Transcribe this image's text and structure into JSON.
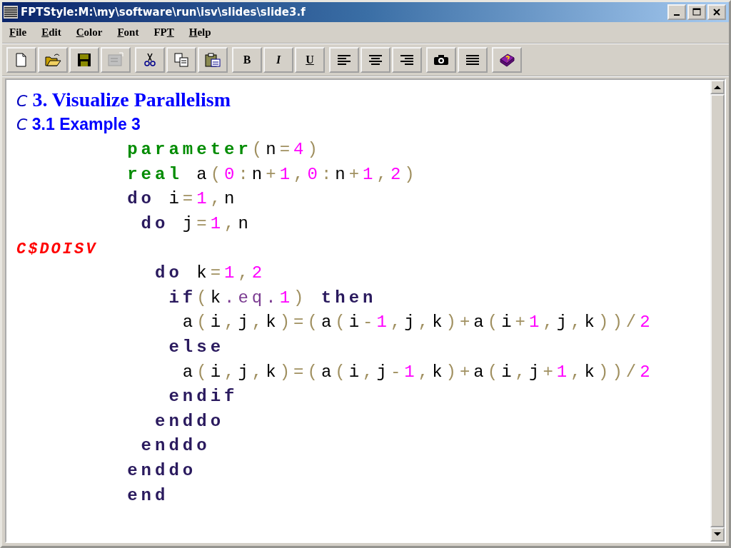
{
  "window": {
    "title": "FPTStyle:M:\\my\\software\\run\\isv\\slides\\slide3.f"
  },
  "menu": [
    {
      "accelerator": "F",
      "after": "ile"
    },
    {
      "accelerator": "E",
      "after": "dit"
    },
    {
      "accelerator": "C",
      "after": "olor"
    },
    {
      "accelerator": "F",
      "after": "ont"
    },
    {
      "before": "FP",
      "accelerator": "T"
    },
    {
      "accelerator": "H",
      "after": "elp"
    }
  ],
  "toolbar": [
    [
      {
        "kind": "icon",
        "disabled": false
      },
      {
        "kind": "icon",
        "disabled": false
      },
      {
        "kind": "icon",
        "disabled": false
      },
      {
        "kind": "icon",
        "disabled": true
      }
    ],
    [
      {
        "kind": "icon",
        "disabled": false
      },
      {
        "kind": "icon",
        "disabled": false
      },
      {
        "kind": "icon",
        "disabled": false
      }
    ],
    [
      {
        "kind": "text",
        "label": "B",
        "disabled": false
      },
      {
        "kind": "text",
        "label": "I",
        "disabled": false
      },
      {
        "kind": "text",
        "label": "U",
        "disabled": false
      }
    ],
    [
      {
        "kind": "icon",
        "disabled": false
      },
      {
        "kind": "icon",
        "disabled": false
      },
      {
        "kind": "icon",
        "disabled": false
      }
    ],
    [
      {
        "kind": "icon",
        "disabled": false
      },
      {
        "kind": "icon",
        "disabled": false
      }
    ],
    [
      {
        "kind": "icon",
        "disabled": false
      }
    ]
  ],
  "editor": {
    "lines": [
      [
        {
          "kind": "comment-mark",
          "text": "C"
        },
        {
          "kind": "heading",
          "text": " 3. Visualize Parallelism"
        }
      ],
      [
        {
          "kind": "comment-mark",
          "text": "C"
        },
        {
          "kind": "subheading",
          "text": " 3.1 Example 3"
        }
      ],
      [
        {
          "kind": "decl",
          "text": "        parameter"
        },
        {
          "kind": "op",
          "text": "("
        },
        {
          "kind": "ident",
          "text": "n"
        },
        {
          "kind": "op",
          "text": "="
        },
        {
          "kind": "number",
          "text": "4"
        },
        {
          "kind": "op",
          "text": ")"
        }
      ],
      [
        {
          "kind": "decl",
          "text": "        real"
        },
        {
          "kind": "ident",
          "text": " a"
        },
        {
          "kind": "op",
          "text": "("
        },
        {
          "kind": "number",
          "text": "0"
        },
        {
          "kind": "op",
          "text": ":"
        },
        {
          "kind": "ident",
          "text": "n"
        },
        {
          "kind": "op",
          "text": "+"
        },
        {
          "kind": "number",
          "text": "1"
        },
        {
          "kind": "op",
          "text": ","
        },
        {
          "kind": "number",
          "text": "0"
        },
        {
          "kind": "op",
          "text": ":"
        },
        {
          "kind": "ident",
          "text": "n"
        },
        {
          "kind": "op",
          "text": "+"
        },
        {
          "kind": "number",
          "text": "1"
        },
        {
          "kind": "op",
          "text": ","
        },
        {
          "kind": "number",
          "text": "2"
        },
        {
          "kind": "op",
          "text": ")"
        }
      ],
      [
        {
          "kind": "keyword",
          "text": "        do"
        },
        {
          "kind": "ident",
          "text": " i"
        },
        {
          "kind": "op",
          "text": "="
        },
        {
          "kind": "number",
          "text": "1"
        },
        {
          "kind": "op",
          "text": ","
        },
        {
          "kind": "ident",
          "text": "n"
        }
      ],
      [
        {
          "kind": "keyword",
          "text": "         do"
        },
        {
          "kind": "ident",
          "text": " j"
        },
        {
          "kind": "op",
          "text": "="
        },
        {
          "kind": "number",
          "text": "1"
        },
        {
          "kind": "op",
          "text": ","
        },
        {
          "kind": "ident",
          "text": "n"
        }
      ],
      [
        {
          "kind": "directive",
          "text": "C$DOISV"
        }
      ],
      [
        {
          "kind": "keyword",
          "text": "          do"
        },
        {
          "kind": "ident",
          "text": " k"
        },
        {
          "kind": "op",
          "text": "="
        },
        {
          "kind": "number",
          "text": "1"
        },
        {
          "kind": "op",
          "text": ","
        },
        {
          "kind": "number",
          "text": "2"
        }
      ],
      [
        {
          "kind": "keyword",
          "text": "           if"
        },
        {
          "kind": "op",
          "text": "("
        },
        {
          "kind": "ident",
          "text": "k"
        },
        {
          "kind": "relop",
          "text": ".eq."
        },
        {
          "kind": "number",
          "text": "1"
        },
        {
          "kind": "op",
          "text": ")"
        },
        {
          "kind": "keyword",
          "text": " then"
        }
      ],
      [
        {
          "kind": "ident",
          "text": "            a"
        },
        {
          "kind": "op",
          "text": "("
        },
        {
          "kind": "ident",
          "text": "i"
        },
        {
          "kind": "op",
          "text": ","
        },
        {
          "kind": "ident",
          "text": "j"
        },
        {
          "kind": "op",
          "text": ","
        },
        {
          "kind": "ident",
          "text": "k"
        },
        {
          "kind": "op",
          "text": ")=("
        },
        {
          "kind": "ident",
          "text": "a"
        },
        {
          "kind": "op",
          "text": "("
        },
        {
          "kind": "ident",
          "text": "i"
        },
        {
          "kind": "op",
          "text": "-"
        },
        {
          "kind": "number",
          "text": "1"
        },
        {
          "kind": "op",
          "text": ","
        },
        {
          "kind": "ident",
          "text": "j"
        },
        {
          "kind": "op",
          "text": ","
        },
        {
          "kind": "ident",
          "text": "k"
        },
        {
          "kind": "op",
          "text": ")+"
        },
        {
          "kind": "ident",
          "text": "a"
        },
        {
          "kind": "op",
          "text": "("
        },
        {
          "kind": "ident",
          "text": "i"
        },
        {
          "kind": "op",
          "text": "+"
        },
        {
          "kind": "number",
          "text": "1"
        },
        {
          "kind": "op",
          "text": ","
        },
        {
          "kind": "ident",
          "text": "j"
        },
        {
          "kind": "op",
          "text": ","
        },
        {
          "kind": "ident",
          "text": "k"
        },
        {
          "kind": "op",
          "text": "))/"
        },
        {
          "kind": "number",
          "text": "2"
        }
      ],
      [
        {
          "kind": "keyword",
          "text": "           else"
        }
      ],
      [
        {
          "kind": "ident",
          "text": "            a"
        },
        {
          "kind": "op",
          "text": "("
        },
        {
          "kind": "ident",
          "text": "i"
        },
        {
          "kind": "op",
          "text": ","
        },
        {
          "kind": "ident",
          "text": "j"
        },
        {
          "kind": "op",
          "text": ","
        },
        {
          "kind": "ident",
          "text": "k"
        },
        {
          "kind": "op",
          "text": ")=("
        },
        {
          "kind": "ident",
          "text": "a"
        },
        {
          "kind": "op",
          "text": "("
        },
        {
          "kind": "ident",
          "text": "i"
        },
        {
          "kind": "op",
          "text": ","
        },
        {
          "kind": "ident",
          "text": "j"
        },
        {
          "kind": "op",
          "text": "-"
        },
        {
          "kind": "number",
          "text": "1"
        },
        {
          "kind": "op",
          "text": ","
        },
        {
          "kind": "ident",
          "text": "k"
        },
        {
          "kind": "op",
          "text": ")+"
        },
        {
          "kind": "ident",
          "text": "a"
        },
        {
          "kind": "op",
          "text": "("
        },
        {
          "kind": "ident",
          "text": "i"
        },
        {
          "kind": "op",
          "text": ","
        },
        {
          "kind": "ident",
          "text": "j"
        },
        {
          "kind": "op",
          "text": "+"
        },
        {
          "kind": "number",
          "text": "1"
        },
        {
          "kind": "op",
          "text": ","
        },
        {
          "kind": "ident",
          "text": "k"
        },
        {
          "kind": "op",
          "text": "))/"
        },
        {
          "kind": "number",
          "text": "2"
        }
      ],
      [
        {
          "kind": "keyword",
          "text": "           endif"
        }
      ],
      [
        {
          "kind": "keyword",
          "text": "          enddo"
        }
      ],
      [
        {
          "kind": "keyword",
          "text": "         enddo"
        }
      ],
      [
        {
          "kind": "keyword",
          "text": "        enddo"
        }
      ],
      [
        {
          "kind": "keyword",
          "text": "        end"
        }
      ]
    ]
  }
}
